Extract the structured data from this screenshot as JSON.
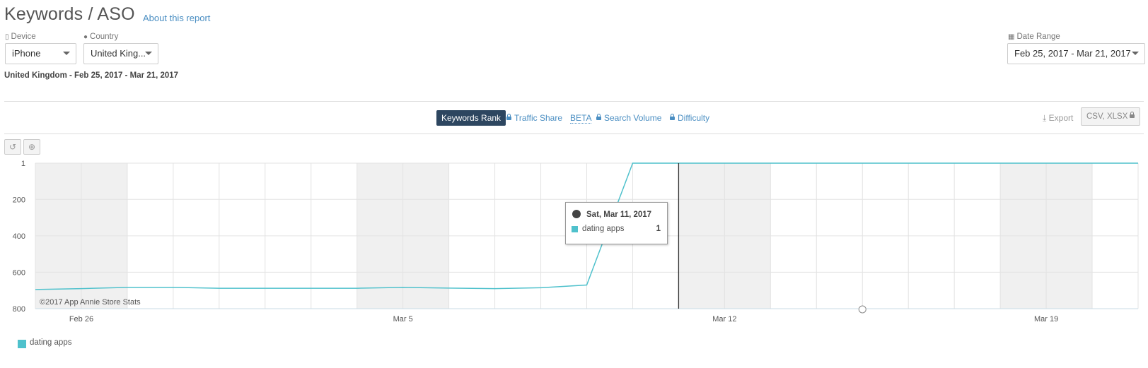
{
  "header": {
    "title": "Keywords / ASO",
    "about_link": "About this report"
  },
  "filters": {
    "device": {
      "label": "Device",
      "value": "iPhone",
      "icon": "phone-icon"
    },
    "country": {
      "label": "Country",
      "value": "United King...",
      "icon": "globe-icon"
    },
    "date_range": {
      "label": "Date Range",
      "value": "Feb 25, 2017 - Mar 21, 2017",
      "icon": "calendar-icon"
    }
  },
  "subtitle": "United Kingdom - Feb 25, 2017 - Mar 21, 2017",
  "tabs": {
    "keywords_rank": "Keywords Rank",
    "traffic_share": "Traffic Share",
    "beta": "BETA",
    "search_volume": "Search Volume",
    "difficulty": "Difficulty"
  },
  "export": {
    "label": "Export",
    "formats": "CSV, XLSX"
  },
  "zoom_controls": {
    "reset_icon": "undo-icon",
    "zoom_icon": "zoom-in-icon"
  },
  "colors": {
    "series": "#4fc1cc",
    "accent_dark": "#2d4660",
    "link": "#4a8ec2",
    "weekend_band": "#f0f0f0"
  },
  "chart_data": {
    "type": "line",
    "x_start": "2017-02-25",
    "x": [
      "Feb 25",
      "Feb 26",
      "Feb 27",
      "Feb 28",
      "Mar 1",
      "Mar 2",
      "Mar 3",
      "Mar 4",
      "Mar 5",
      "Mar 6",
      "Mar 7",
      "Mar 8",
      "Mar 9",
      "Mar 10",
      "Mar 11",
      "Mar 12",
      "Mar 13",
      "Mar 14",
      "Mar 15",
      "Mar 16",
      "Mar 17",
      "Mar 18",
      "Mar 19",
      "Mar 20",
      "Mar 21"
    ],
    "x_tick_labels": [
      "Feb 26",
      "Mar 5",
      "Mar 12",
      "Mar 19"
    ],
    "y_tick_labels": [
      "1",
      "200",
      "400",
      "600",
      "800"
    ],
    "ylim": [
      1,
      800
    ],
    "y_reversed": true,
    "series": [
      {
        "name": "dating apps",
        "values": [
          695,
          690,
          683,
          683,
          688,
          688,
          688,
          688,
          683,
          687,
          690,
          685,
          670,
          1,
          1,
          1,
          1,
          1,
          1,
          1,
          1,
          1,
          1,
          1,
          1
        ]
      }
    ],
    "weekend_days": [
      "Feb 25",
      "Feb 26",
      "Mar 4",
      "Mar 5",
      "Mar 11",
      "Mar 12",
      "Mar 18",
      "Mar 19"
    ],
    "watermark": "©2017 App Annie Store Stats",
    "grid": true,
    "legend_position": "bottom-left",
    "tooltip": {
      "date": "Sat, Mar 11, 2017",
      "series": "dating apps",
      "value": "1"
    }
  }
}
